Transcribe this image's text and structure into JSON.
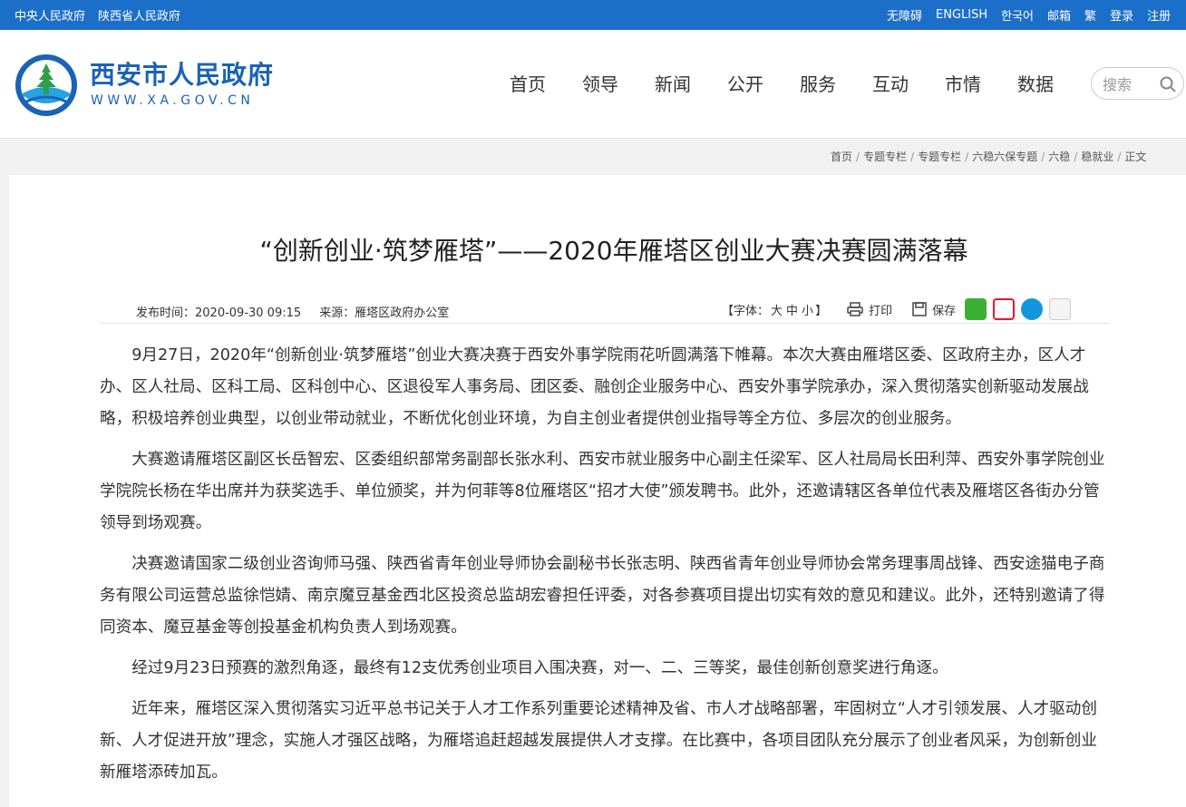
{
  "topbar": {
    "left_links": [
      "中央人民政府",
      "陕西省人民政府"
    ],
    "right_links": [
      "无障碍",
      "ENGLISH",
      "한국어",
      "邮箱",
      "繁",
      "登录",
      "注册"
    ]
  },
  "header": {
    "site_name": "西安市人民政府",
    "site_url": "WWW.XA.GOV.CN",
    "nav": [
      "首页",
      "领导",
      "新闻",
      "公开",
      "服务",
      "互动",
      "市情",
      "数据"
    ],
    "search_placeholder": "搜索"
  },
  "breadcrumb": [
    "首页",
    "专题专栏",
    "专题专栏",
    "六稳六保专题",
    "六稳",
    "稳就业",
    "正文"
  ],
  "article": {
    "title": "“创新创业·筑梦雁塔”——2020年雁塔区创业大赛决赛圆满落幕",
    "publish_time": "发布时间：2020-09-30 09:15",
    "source": "来源：雁塔区政府办公室",
    "font_size_label": "【字体：",
    "font_sizes": [
      "大",
      "中",
      "小"
    ],
    "font_size_end": "】",
    "print_label": "打印",
    "save_label": "保存",
    "paragraphs": [
      "9月27日，2020年“创新创业·筑梦雁塔”创业大赛决赛于西安外事学院雨花听圆满落下帷幕。本次大赛由雁塔区委、区政府主办，区人才办、区人社局、区科工局、区科创中心、区退役军人事务局、团区委、融创企业服务中心、西安外事学院承办，深入贯彻落实创新驱动发展战略，积极培养创业典型，以创业带动就业，不断优化创业环境，为自主创业者提供创业指导等全方位、多层次的创业服务。",
      "大赛邀请雁塔区副区长岳智宏、区委组织部常务副部长张水利、西安市就业服务中心副主任梁军、区人社局局长田利萍、西安外事学院创业学院院长杨在华出席并为获奖选手、单位颁奖，并为何菲等8位雁塔区“招才大使”颁发聘书。此外，还邀请辖区各单位代表及雁塔区各街办分管领导到场观赛。",
      "决赛邀请国家二级创业咨询师马强、陕西省青年创业导师协会副秘书长张志明、陕西省青年创业导师协会常务理事周战锋、西安途猫电子商务有限公司运营总监徐恺婧、南京魔豆基金西北区投资总监胡宏睿担任评委，对各参赛项目提出切实有效的意见和建议。此外，还特别邀请了得同资本、魔豆基金等创投基金机构负责人到场观赛。",
      "经过9月23日预赛的激烈角逐，最终有12支优秀创业项目入围决赛，对一、二、三等奖，最佳创新创意奖进行角逐。",
      "近年来，雁塔区深入贯彻落实习近平总书记关于人才工作系列重要论述精神及省、市人才战略部署，牢固树立“人才引领发展、人才驱动创新、人才促进开放”理念，实施人才强区战略，为雁塔追赶超越发展提供人才支撑。在比赛中，各项目团队充分展示了创业者风采，为创新创业新雁塔添砖加瓦。"
    ]
  },
  "colors": {
    "topbar": "#1c6fc8",
    "brand": "#1a63b6",
    "wechat": "#3cb034",
    "weibo": "#e6162d",
    "qq": "#1296db"
  }
}
